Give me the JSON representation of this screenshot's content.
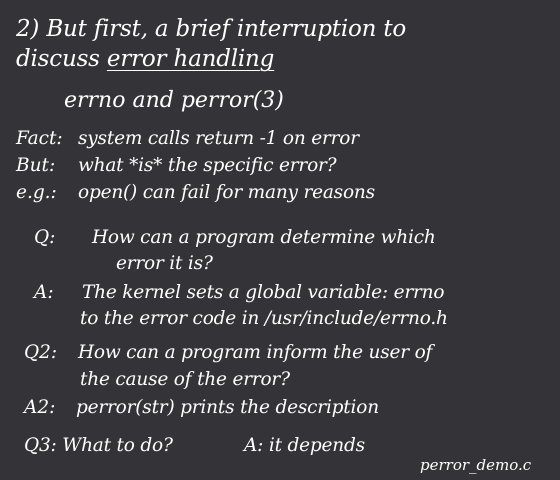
{
  "heading": {
    "line1": "2) But first, a brief interruption to",
    "line2_prefix": "discuss ",
    "line2_underlined": "error handling"
  },
  "subheading": "errno and perror(3)",
  "facts": [
    {
      "label": "Fact:",
      "text": "system calls return -1 on error"
    },
    {
      "label": "But:",
      "text": "what *is* the specific error?"
    },
    {
      "label": "e.g.:",
      "text": "open() can fail for many reasons"
    }
  ],
  "qa": {
    "q1_label": "Q:",
    "q1_line1": "How can a program determine which",
    "q1_line2": "error it is?",
    "a1_label": "A:",
    "a1_line1": "The kernel sets a global variable: errno",
    "a1_line2": "to the error code in /usr/include/errno.h",
    "q2_label": "Q2:",
    "q2_line1": "How can a program inform the user of",
    "q2_line2": "the cause of the error?",
    "a2_label": "A2:",
    "a2_text": "perror(str) prints the description",
    "q3_text": "Q3: What to do?",
    "a3_text": "A: it depends"
  },
  "footer_filename": "perror_demo.c"
}
